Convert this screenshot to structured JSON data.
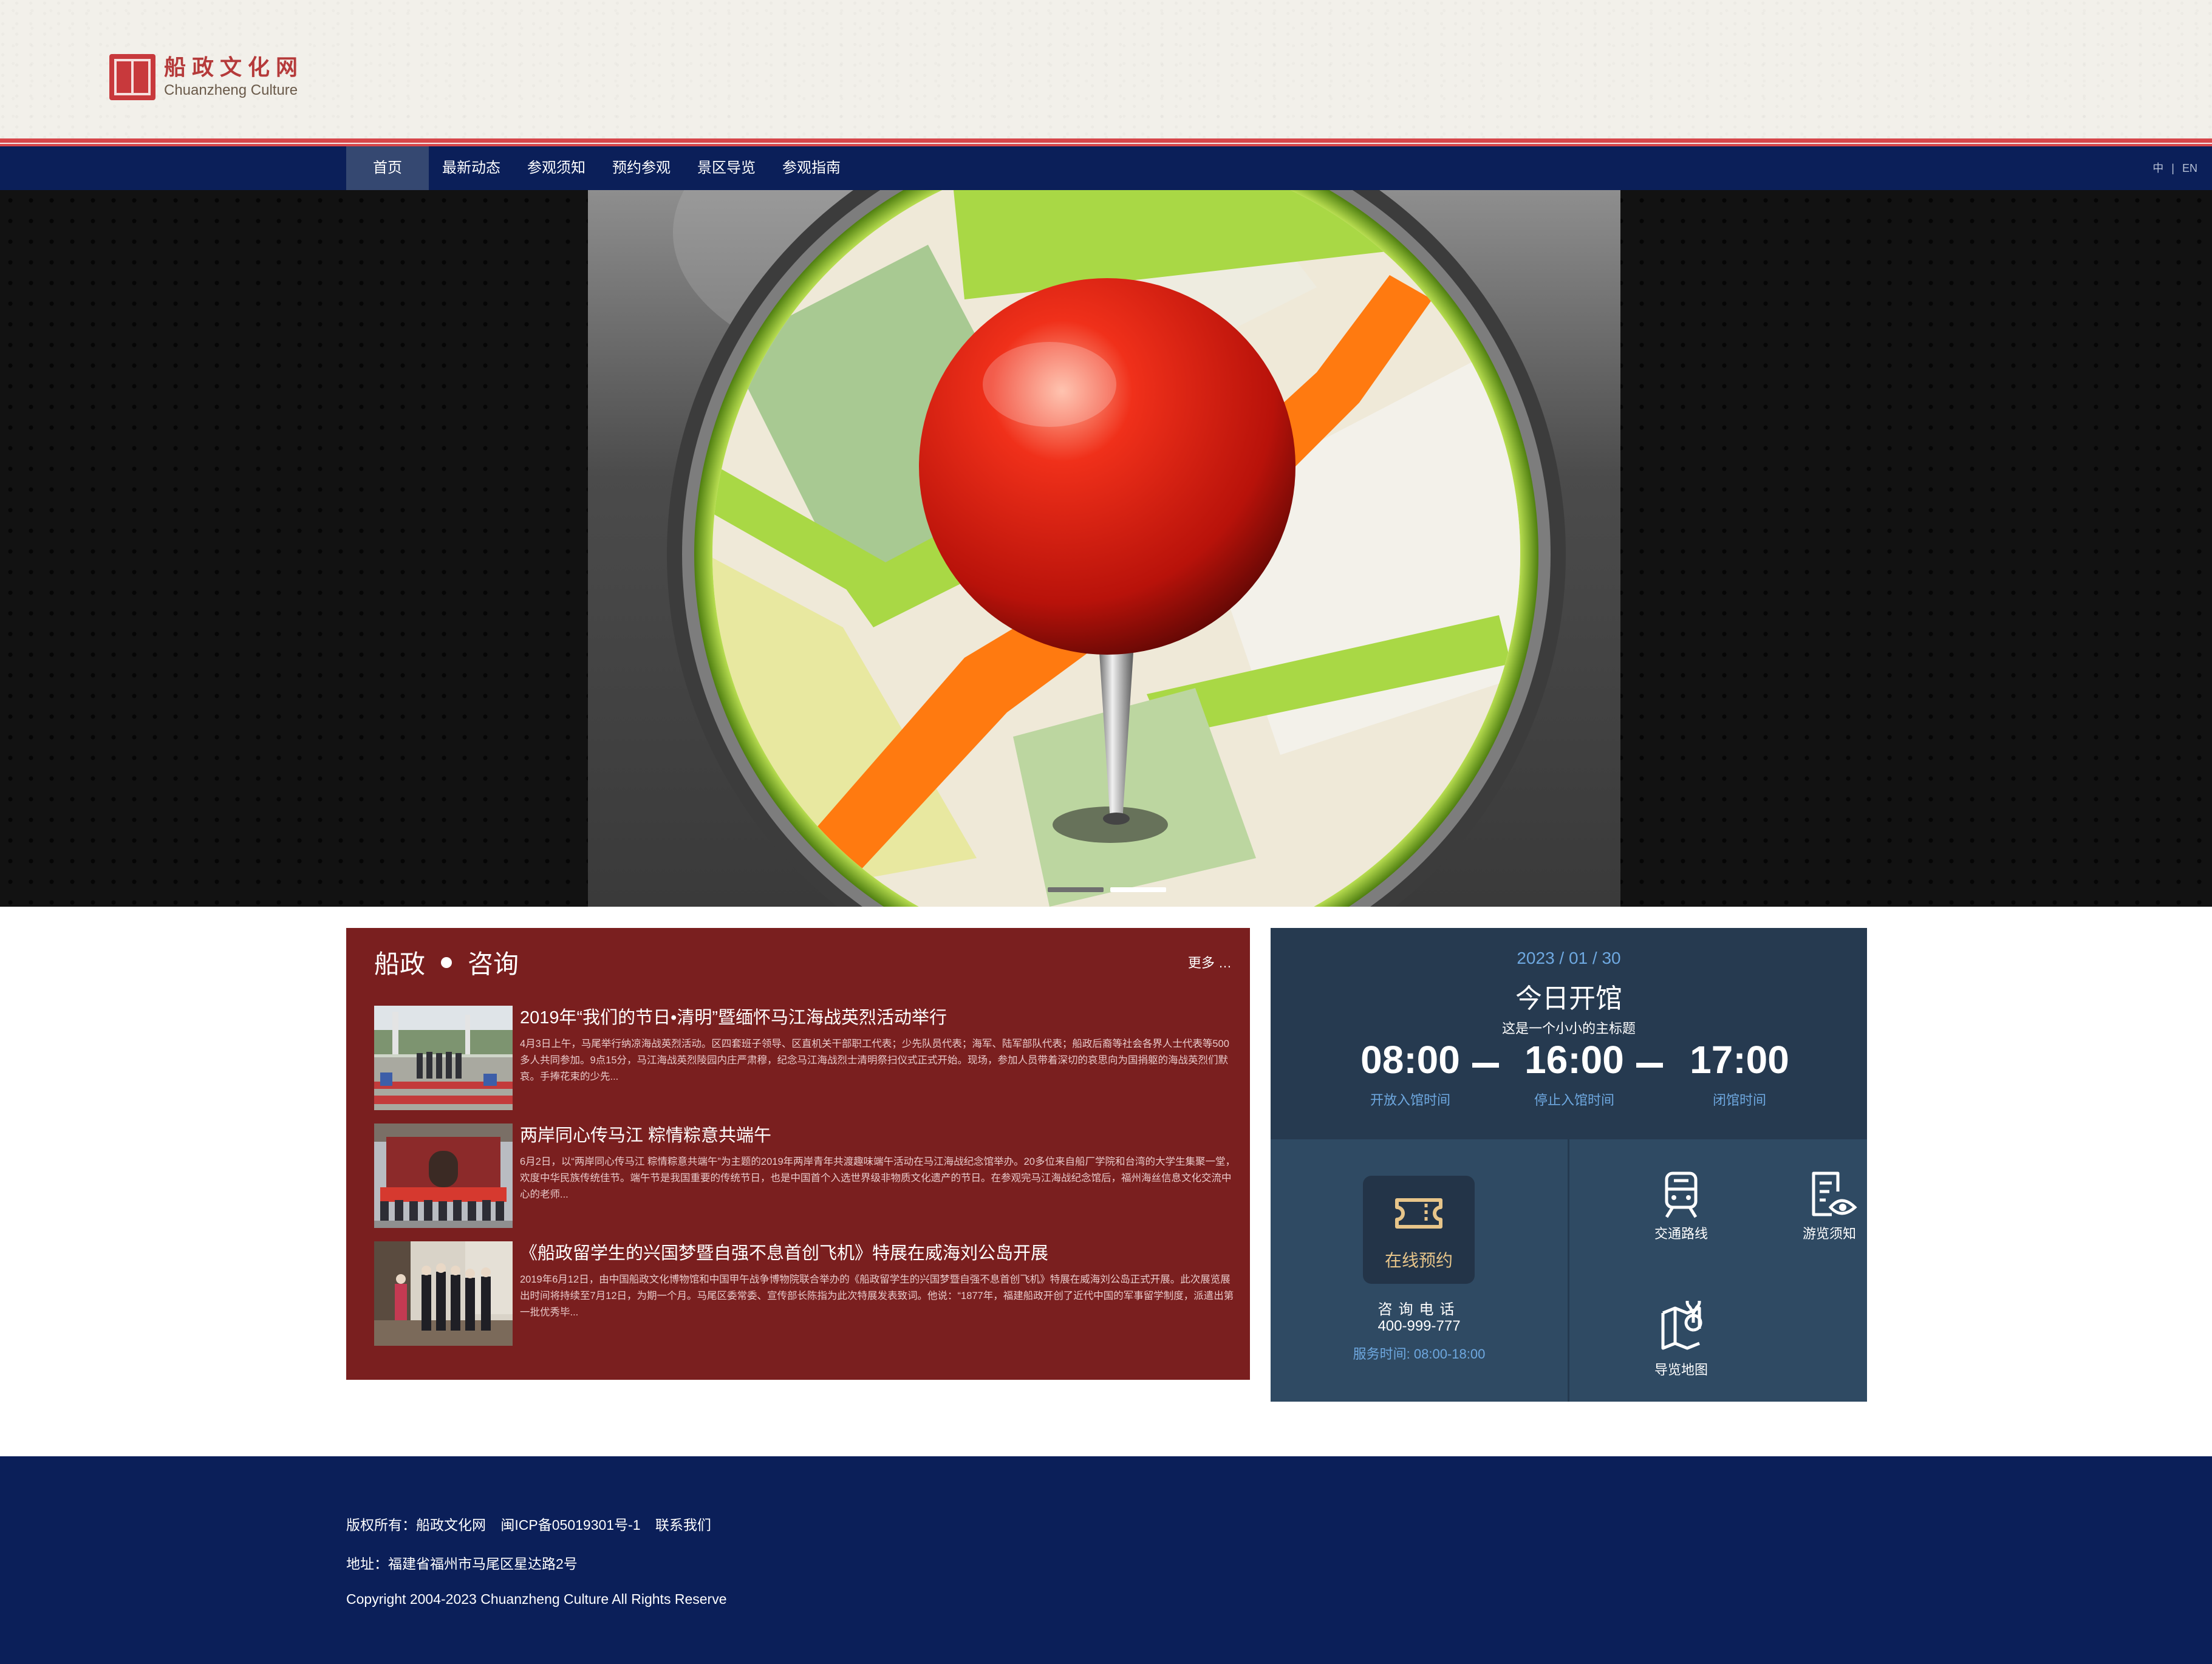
{
  "site": {
    "logo_cn": "船政文化网",
    "logo_en": "Chuanzheng Culture",
    "seal_text": "船政文化"
  },
  "nav": {
    "items": [
      {
        "label": "首页",
        "active": true
      },
      {
        "label": "最新动态"
      },
      {
        "label": "参观须知"
      },
      {
        "label": "预约参观"
      },
      {
        "label": "景区导览"
      },
      {
        "label": "参观指南"
      }
    ],
    "lang_zh": "中",
    "lang_sep": "|",
    "lang_en": "EN"
  },
  "banner": {
    "icon": "map-pin-icon",
    "slides": 2,
    "active_slide": 2
  },
  "news": {
    "title_a": "船政",
    "title_b": "咨询",
    "more": "更多 …",
    "items": [
      {
        "title": "2019年“我们的节日•清明”暨缅怀马江海战英烈活动举行",
        "body": "4月3日上午，马尾举行纳凉海战英烈活动。区四套班子领导、区直机关干部职工代表；少先队员代表；海军、陆军部队代表；船政后裔等社会各界人士代表等500多人共同参加。9点15分，马江海战英烈陵园内庄严肃穆，纪念马江海战烈士清明祭扫仪式正式开始。现场，参加人员带着深切的哀思向为国捐躯的海战英烈们默哀。手捧花束的少先..."
      },
      {
        "title": "两岸同心传马江 粽情粽意共端午",
        "body": "6月2日，以“两岸同心传马江 粽情粽意共端午”为主题的2019年两岸青年共渡趣味端午活动在马江海战纪念馆举办。20多位来自船厂学院和台湾的大学生集聚一堂，欢度中华民族传统佳节。端午节是我国重要的传统节日，也是中国首个入选世界级非物质文化遗产的节日。在参观完马江海战纪念馆后，福州海丝信息文化交流中心的老师..."
      },
      {
        "title": "《船政留学生的兴国梦暨自强不息首创飞机》特展在威海刘公岛开展",
        "body": "2019年6月12日，由中国船政文化博物馆和中国甲午战争博物院联合举办的《船政留学生的兴国梦暨自强不息首创飞机》特展在威海刘公岛正式开展。此次展览展出时间将持续至7月12日，为期一个月。马尾区委常委、宣传部长陈指为此次特展发表致词。他说：“1877年，福建船政开创了近代中国的军事留学制度，派遣出第一批优秀毕..."
      }
    ]
  },
  "hours": {
    "date": "2023 / 01 / 30",
    "title": "今日开馆",
    "subtitle": "这是一个小小的主标题",
    "times": [
      {
        "time": "08:00",
        "caption": "开放入馆时间"
      },
      {
        "time": "16:00",
        "caption": "停止入馆时间"
      },
      {
        "time": "17:00",
        "caption": "闭馆时间"
      }
    ],
    "book_label": "在线预约",
    "consult_label": "咨询电话",
    "phone": "400-999-777",
    "service_hours": "服务时间: 08:00-18:00",
    "links": [
      {
        "label": "交通路线",
        "icon": "train-icon"
      },
      {
        "label": "游览须知",
        "icon": "document-eye-icon"
      },
      {
        "label": "导览地图",
        "icon": "map-guide-icon"
      }
    ]
  },
  "footer": {
    "copyright_label": "版权所有：船政文化网",
    "icp": "闽ICP备05019301号-1",
    "contact": "联系我们",
    "address": "地址：福建省福州市马尾区星达路2号",
    "copyright_en": "Copyright 2004-2023 Chuanzheng Culture All Rights Reserve"
  },
  "colors": {
    "nav_bg": "#0b1f59",
    "red_line": "#d7464a",
    "news_bg": "#7a1f1f",
    "hours_top": "#263a50",
    "hours_bottom": "#2f4a63",
    "accent_blue": "#6ea8e0",
    "book_gold": "#e7c58a"
  }
}
